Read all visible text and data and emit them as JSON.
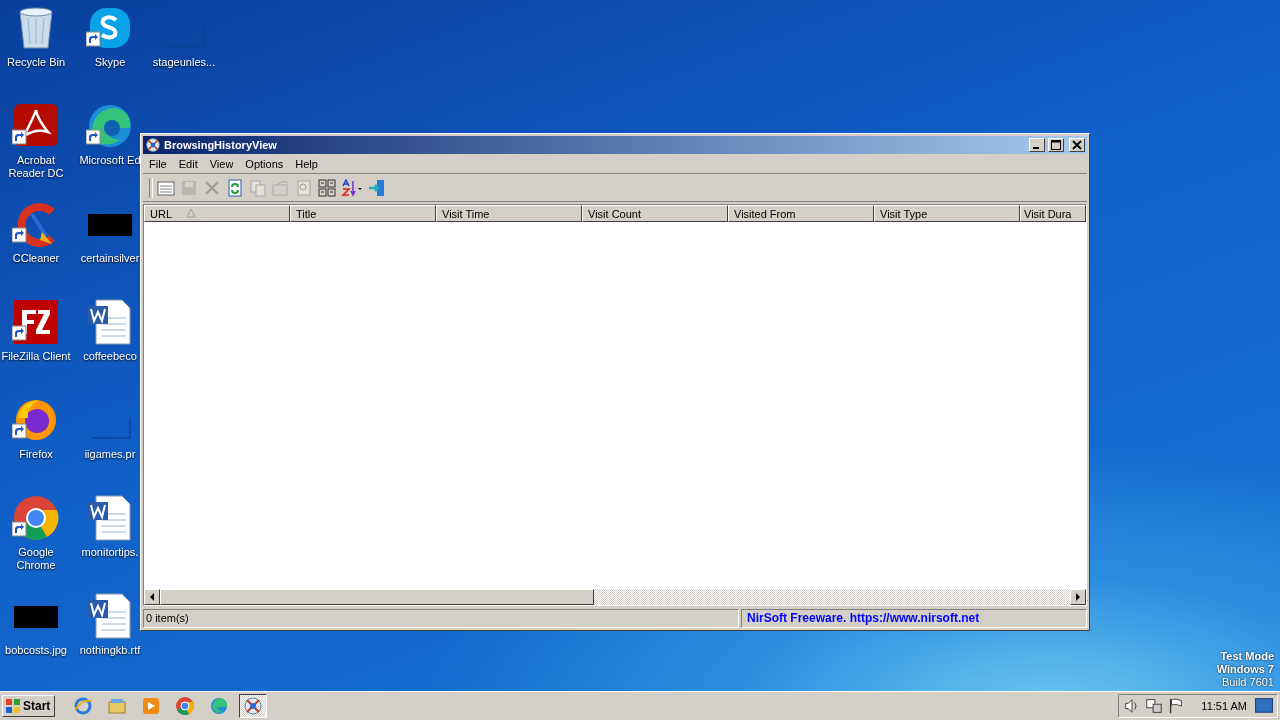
{
  "desktop": {
    "icons": [
      {
        "label": "Recycle Bin",
        "kind": "recycle",
        "shortcut": false
      },
      {
        "label": "Acrobat Reader DC",
        "kind": "acrobat",
        "shortcut": true
      },
      {
        "label": "CCleaner",
        "kind": "ccleaner",
        "shortcut": true
      },
      {
        "label": "FileZilla Client",
        "kind": "filezilla",
        "shortcut": true
      },
      {
        "label": "Firefox",
        "kind": "firefox",
        "shortcut": true
      },
      {
        "label": "Google Chrome",
        "kind": "chrome",
        "shortcut": true
      },
      {
        "label": "bobcosts.jpg",
        "kind": "thumb",
        "shortcut": false
      },
      {
        "label": "Skype",
        "kind": "skype",
        "shortcut": true
      },
      {
        "label": "Microsoft Ed",
        "kind": "edge",
        "shortcut": true
      },
      {
        "label": "certainsilver",
        "kind": "thumb",
        "shortcut": false
      },
      {
        "label": "coffeebeco",
        "kind": "word",
        "shortcut": false
      },
      {
        "label": "iigames.pr",
        "kind": "blank",
        "shortcut": false
      },
      {
        "label": "monitortips.",
        "kind": "word",
        "shortcut": false
      },
      {
        "label": "nothingkb.rtf",
        "kind": "word",
        "shortcut": false
      },
      {
        "label": "stageunles...",
        "kind": "blank",
        "shortcut": false
      }
    ]
  },
  "window": {
    "title": "BrowsingHistoryView",
    "menu": [
      "File",
      "Edit",
      "View",
      "Options",
      "Help"
    ],
    "toolbar": [
      {
        "kind": "list",
        "disabled": false
      },
      {
        "kind": "save",
        "disabled": true
      },
      {
        "kind": "delete",
        "disabled": true
      },
      {
        "kind": "refresh",
        "disabled": false
      },
      {
        "kind": "copy",
        "disabled": true
      },
      {
        "kind": "properties",
        "disabled": true
      },
      {
        "kind": "find",
        "disabled": true
      },
      {
        "kind": "report",
        "disabled": false
      },
      {
        "kind": "sort",
        "disabled": false
      },
      {
        "kind": "exit",
        "disabled": false
      }
    ],
    "table": {
      "columns": [
        {
          "label": "URL",
          "sorted": true
        },
        {
          "label": "Title"
        },
        {
          "label": "Visit Time"
        },
        {
          "label": "Visit Count"
        },
        {
          "label": "Visited From"
        },
        {
          "label": "Visit Type"
        },
        {
          "label": "Visit Dura"
        }
      ]
    },
    "status_bar": {
      "count": "0 item(s)",
      "link": "NirSoft Freeware. https://www.nirsoft.net"
    }
  },
  "taskbar": {
    "start": "Start",
    "items": [
      {
        "kind": "ie",
        "selected": false
      },
      {
        "kind": "explorer",
        "selected": false
      },
      {
        "kind": "media",
        "selected": false
      },
      {
        "kind": "chrome",
        "selected": false
      },
      {
        "kind": "edge",
        "selected": false
      },
      {
        "kind": "app",
        "selected": true
      }
    ],
    "tray": [
      {
        "kind": "speaker"
      },
      {
        "kind": "network"
      },
      {
        "kind": "flag"
      }
    ],
    "clock": "11:51 AM"
  },
  "watermark_lines": [
    "Test Mode",
    "Windows 7",
    "Build 7601"
  ]
}
